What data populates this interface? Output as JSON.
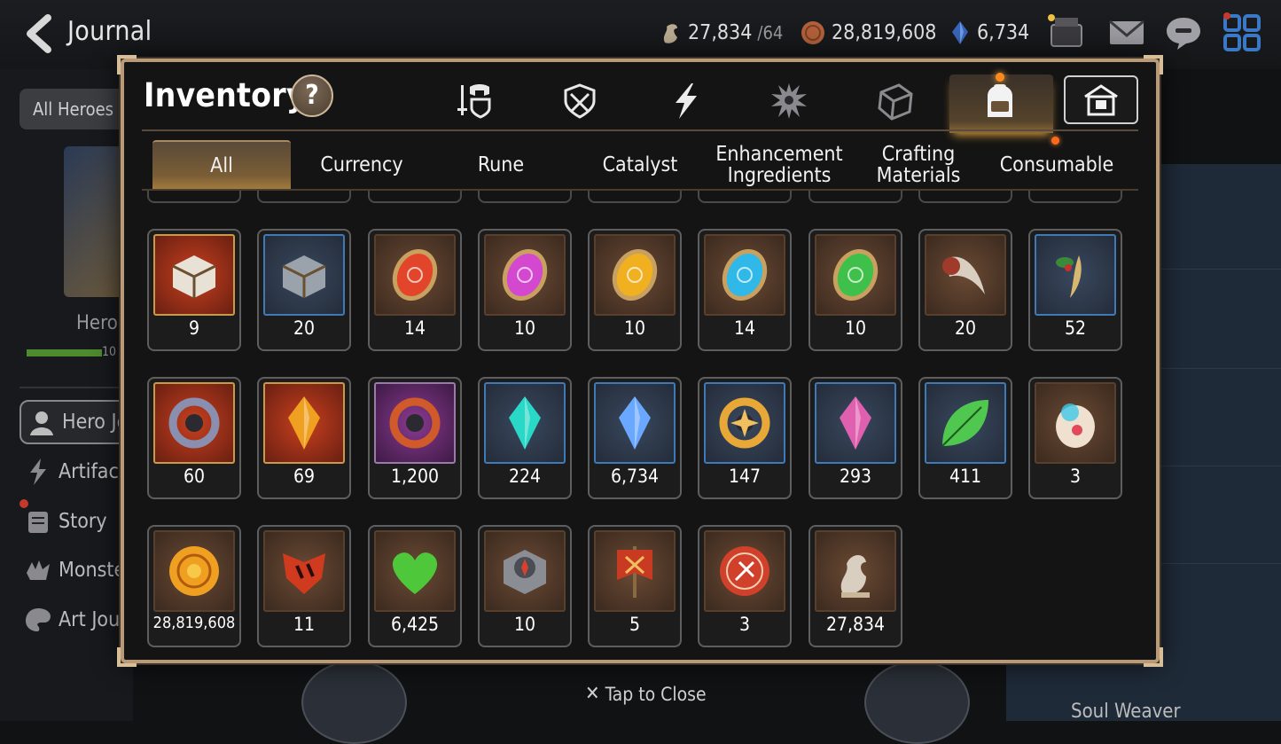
{
  "header": {
    "back_icon": "chevron-left-icon",
    "title": "Journal",
    "resources": [
      {
        "icon": "skystone-icon",
        "value": "27,834",
        "suffix": "/64",
        "color": "#b8aa90"
      },
      {
        "icon": "gold-icon",
        "value": "28,819,608",
        "color": "#b0603a"
      },
      {
        "icon": "crystal-icon",
        "value": "6,734",
        "color": "#4a7ad0"
      }
    ],
    "top_icons": [
      "shop-icon",
      "mail-icon",
      "chat-icon",
      "menu-grid-icon"
    ]
  },
  "background": {
    "filter_label": "All Heroes",
    "hero_label": "Hero",
    "hero_progress_text": "10",
    "side_items": [
      {
        "label": "Hero Journal",
        "icon": "hero-icon"
      },
      {
        "label": "Artifact",
        "icon": "artifact-icon"
      },
      {
        "label": "Story",
        "icon": "story-icon"
      },
      {
        "label": "Monster",
        "icon": "monster-icon"
      },
      {
        "label": "Art Journal",
        "icon": "palette-icon"
      }
    ],
    "right_label": "Soul Weaver"
  },
  "modal": {
    "title": "Inventory",
    "help_label": "?",
    "categories": [
      {
        "icon": "equipment-icon",
        "active": false
      },
      {
        "icon": "shield-icon",
        "active": false
      },
      {
        "icon": "lightning-icon",
        "active": false
      },
      {
        "icon": "catalyst-splat-icon",
        "active": false
      },
      {
        "icon": "cube-icon",
        "active": false
      },
      {
        "icon": "backpack-icon",
        "active": true
      },
      {
        "icon": "storage-house-icon",
        "active": false
      }
    ],
    "tabs": [
      {
        "label": "All",
        "active": true
      },
      {
        "label": "Currency"
      },
      {
        "label": "Rune"
      },
      {
        "label": "Catalyst"
      },
      {
        "label": "Enhancement Ingredients"
      },
      {
        "label": "Crafting Materials"
      },
      {
        "label": "Consumable",
        "badge": true
      }
    ],
    "rows": [
      [
        {
          "icon": "white-chest-icon",
          "qty": "9",
          "frame": "red",
          "color": "#e8e2d6"
        },
        {
          "icon": "silver-chest-icon",
          "qty": "20",
          "frame": "blue",
          "color": "#9aa2ac"
        },
        {
          "icon": "red-rune-icon",
          "qty": "14",
          "frame": "brown",
          "color": "#e2452a"
        },
        {
          "icon": "pink-rune-icon",
          "qty": "10",
          "frame": "brown",
          "color": "#d448d0"
        },
        {
          "icon": "yellow-rune-icon",
          "qty": "10",
          "frame": "brown",
          "color": "#f0b020"
        },
        {
          "icon": "blue-rune-icon",
          "qty": "14",
          "frame": "brown",
          "color": "#30b8e8"
        },
        {
          "icon": "green-rune-icon",
          "qty": "10",
          "frame": "brown",
          "color": "#3ec04a"
        },
        {
          "icon": "claw-icon",
          "qty": "20",
          "frame": "brown",
          "color": "#a03a2a"
        },
        {
          "icon": "herb-root-icon",
          "qty": "52",
          "frame": "blue",
          "color": "#d8b870"
        }
      ],
      [
        {
          "icon": "ring-pendant-icon",
          "qty": "60",
          "frame": "red",
          "color": "#8a8fb0"
        },
        {
          "icon": "flame-crystal-icon",
          "qty": "69",
          "frame": "red",
          "color": "#f0a020"
        },
        {
          "icon": "dark-ring-icon",
          "qty": "1,200",
          "frame": "purple",
          "color": "#d05a2a"
        },
        {
          "icon": "teal-crystal-icon",
          "qty": "224",
          "frame": "blue",
          "color": "#2ad8c8"
        },
        {
          "icon": "blue-gem-icon",
          "qty": "6,734",
          "frame": "blue",
          "color": "#6aa8ff"
        },
        {
          "icon": "star-medallion-icon",
          "qty": "147",
          "frame": "blue",
          "color": "#e8a838"
        },
        {
          "icon": "pink-crystal-pile-icon",
          "qty": "293",
          "frame": "blue",
          "color": "#e060b0"
        },
        {
          "icon": "green-leaf-icon",
          "qty": "411",
          "frame": "blue",
          "color": "#50c850"
        },
        {
          "icon": "bubble-pod-icon",
          "qty": "3",
          "frame": "brown",
          "color": "#e04a5a"
        }
      ],
      [
        {
          "icon": "gold-coin-icon",
          "qty": "28,819,608",
          "frame": "brown",
          "color": "#f0a020"
        },
        {
          "icon": "red-emblem-icon",
          "qty": "11",
          "frame": "brown",
          "color": "#d03a1e"
        },
        {
          "icon": "green-heart-icon",
          "qty": "6,425",
          "frame": "brown",
          "color": "#4ec83a"
        },
        {
          "icon": "stone-compass-icon",
          "qty": "10",
          "frame": "brown",
          "color": "#8a8e94"
        },
        {
          "icon": "war-banner-icon",
          "qty": "5",
          "frame": "brown",
          "color": "#c83a22"
        },
        {
          "icon": "red-badge-icon",
          "qty": "3",
          "frame": "brown",
          "color": "#d0402a"
        },
        {
          "icon": "skystone-icon",
          "qty": "27,834",
          "frame": "brown",
          "color": "#d8cfc0"
        }
      ]
    ],
    "close_hint": "Tap to Close",
    "close_icon": "close-icon"
  }
}
